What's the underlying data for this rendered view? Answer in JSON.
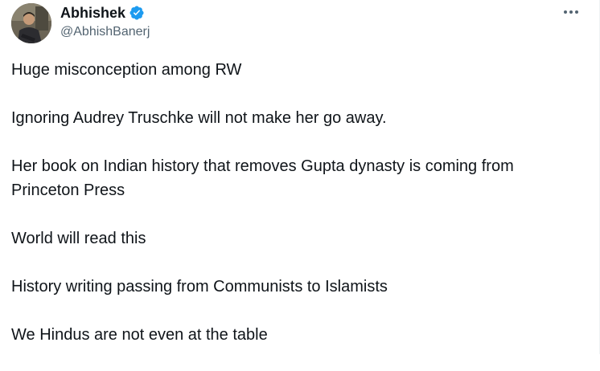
{
  "author": {
    "display_name": "Abhishek",
    "handle": "@AbhishBanerj",
    "verified": true,
    "verified_icon": "verified-badge-icon",
    "verified_color": "#1d9bf0",
    "avatar_icon": "profile-avatar"
  },
  "actions": {
    "more_icon": "more-options-icon"
  },
  "tweet": {
    "paragraphs": [
      "Huge misconception among RW",
      "Ignoring Audrey Truschke will not make her go away.",
      "Her book on Indian history that removes Gupta dynasty is coming from Princeton Press",
      "World will read this",
      "History writing passing from Communists to Islamists",
      "We Hindus are not even at the table"
    ]
  },
  "colors": {
    "text": "#0f1419",
    "secondary": "#536471"
  }
}
